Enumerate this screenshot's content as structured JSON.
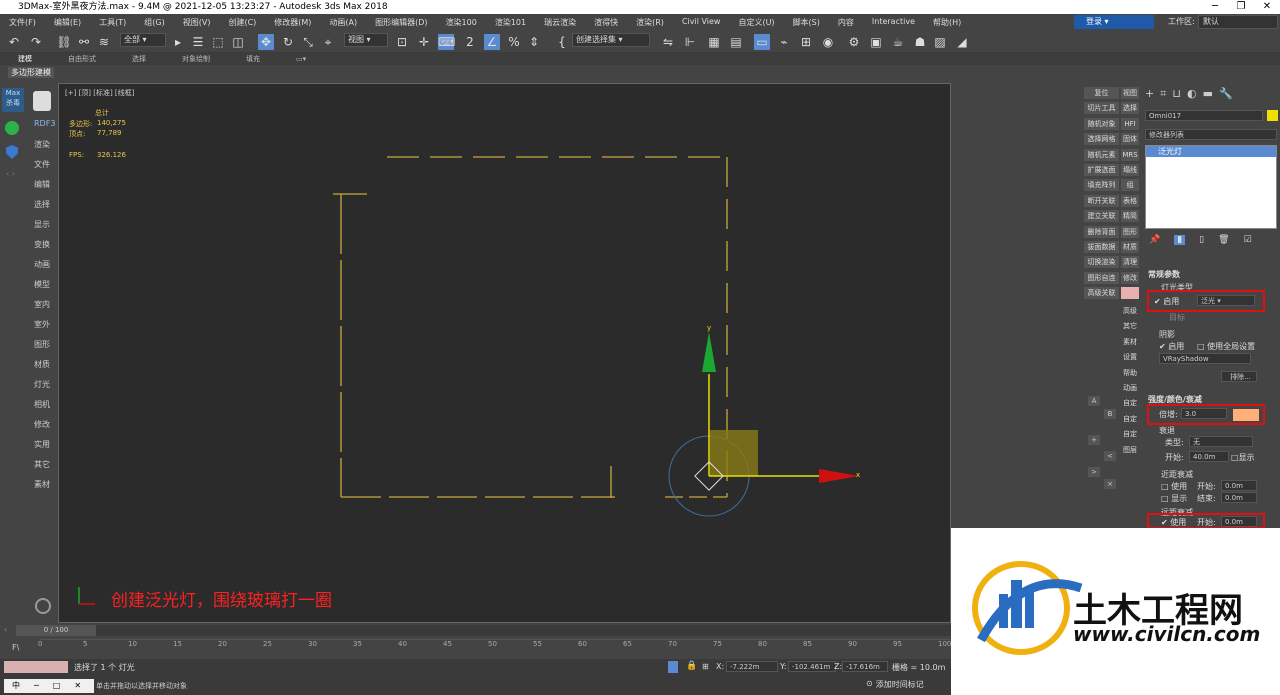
{
  "window": {
    "title": "3DMax-室外黑夜方法.max - 9.4M @ 2021-12-05 13:23:27 - Autodesk 3ds Max 2018"
  },
  "menu": [
    "文件(F)",
    "编辑(E)",
    "工具(T)",
    "组(G)",
    "视图(V)",
    "创建(C)",
    "修改器(M)",
    "动画(A)",
    "图形编辑器(D)",
    "渲染100",
    "渲染101",
    "瑞云渲染",
    "渲得快",
    "渲染(R)",
    "Civil View",
    "自定义(U)",
    "脚本(S)",
    "内容",
    "Interactive",
    "帮助(H)"
  ],
  "login": "登录",
  "workspace_label": "工作区:",
  "workspace_value": "默认",
  "toolbar": {
    "filter": "全部",
    "view": "视图",
    "selset": "创建选择集"
  },
  "ribbon_tabs": [
    "建模",
    "自由形式",
    "选择",
    "对象绘制",
    "填充"
  ],
  "ribbon_sub": "多边形建模",
  "left_tools": [
    "渲染",
    "文件",
    "编辑",
    "选择",
    "显示",
    "变换",
    "动画",
    "模型",
    "室内",
    "室外",
    "图形",
    "材质",
    "灯光",
    "相机",
    "修改",
    "实用",
    "其它",
    "素材"
  ],
  "left_logo": "Max\n杀毒",
  "left_rdf": "RDF3",
  "viewport": {
    "label": "[+] [顶] [标准] [线框]",
    "stats_title": "总计",
    "polys_label": "多边形:",
    "polys": "140,275",
    "verts_label": "顶点:",
    "verts": "77,789",
    "fps_label": "FPS:",
    "fps": "326.126",
    "axis_y": "y",
    "axis_x": "x",
    "annotation": "创建泛光灯，围绕玻璃打一圈"
  },
  "cmd_buttons": [
    [
      "复位",
      "视图"
    ],
    [
      "切片工具",
      "选择"
    ],
    [
      "随机对象",
      "HFI"
    ],
    [
      "选择网格",
      "固体"
    ],
    [
      "随机元素",
      "MRS"
    ],
    [
      "扩展选面",
      "塌线"
    ],
    [
      "填充阵列",
      "组"
    ],
    [
      "断开关联",
      "表格"
    ],
    [
      "建立关联",
      "精简"
    ],
    [
      "删除背面",
      "图形"
    ],
    [
      "拔面数据",
      "材质"
    ],
    [
      "切换渲染",
      "清理"
    ],
    [
      "图形自连",
      "修改"
    ],
    [
      "高级关联",
      ""
    ]
  ],
  "cmd_col2_extra": [
    "高级",
    "其它",
    "素材",
    "设置",
    "帮助",
    "动画",
    "自定",
    "自定",
    "自定",
    "图层"
  ],
  "right_panel": {
    "object_name": "Omni017",
    "modifier_list": "修改器列表",
    "stack_item": "泛光灯",
    "general_params": "常规参数",
    "light_type": "灯光类型",
    "enable": "启用",
    "light_type_value": "泛光",
    "target": "目标",
    "shadows": "阴影",
    "shadows_enable": "启用",
    "use_global": "使用全局设置",
    "shadow_type": "VRayShadow",
    "exclude": "排除...",
    "intensity_section": "强度/颜色/衰减",
    "multiplier_label": "倍增:",
    "multiplier": "3.0",
    "decay": "衰退",
    "type_label": "类型:",
    "type_value": "无",
    "start_label": "开始:",
    "start_value": "40.0m",
    "show": "显示",
    "near_atten": "近距衰减",
    "use": "使用",
    "start2": "开始:",
    "start2_value": "0.0m",
    "show2": "显示",
    "end2": "结束:",
    "end2_value": "0.0m",
    "far_atten": "远距衰减",
    "use3": "使用",
    "start3": "开始:",
    "start3_value": "0.0m"
  },
  "timeline": {
    "frame": "0 / 100",
    "ticks": [
      "0",
      "5",
      "10",
      "15",
      "20",
      "25",
      "30",
      "35",
      "40",
      "45",
      "50",
      "55",
      "60",
      "65",
      "70",
      "75",
      "80",
      "85",
      "90",
      "95",
      "100"
    ]
  },
  "status": {
    "selected": "选择了 1 个 灯光",
    "hint": "单击并拖动以选择并移动对象",
    "x_label": "X:",
    "x": "-7.222m",
    "y_label": "Y:",
    "y": "-102.461m",
    "z_label": "Z:",
    "z": "-17.616m",
    "grid_label": "栅格 = 10.0m",
    "add_time_tag": "添加时间标记"
  },
  "watermark": {
    "name": "土木工程网",
    "url": "www.civilcn.com"
  },
  "colors": {
    "accent": "#5a8ad0",
    "light_color": "#ffb07a",
    "axis_y": "#1aa830",
    "axis_x": "#d01010",
    "annotation": "#ff2020"
  }
}
